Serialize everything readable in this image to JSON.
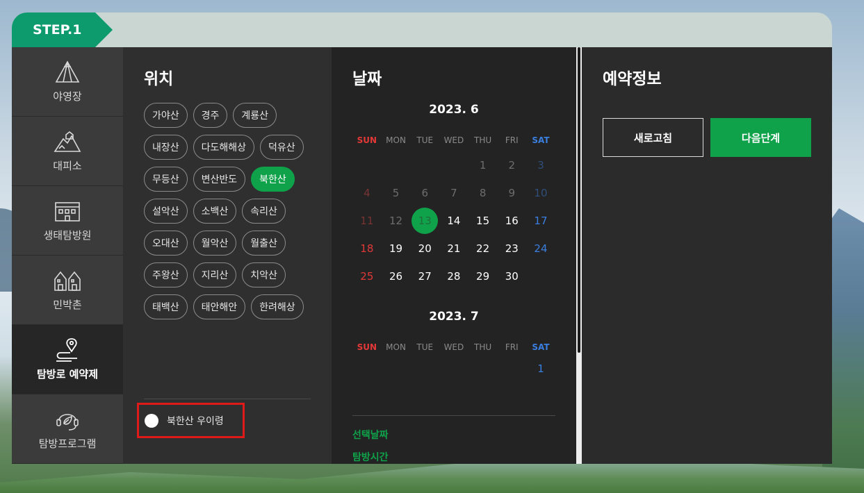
{
  "step": {
    "label": "STEP.1"
  },
  "sidebar": {
    "items": [
      {
        "label": "야영장",
        "icon": "tent-icon",
        "active": false
      },
      {
        "label": "대피소",
        "icon": "mountain-shelter-icon",
        "active": false
      },
      {
        "label": "생태탐방원",
        "icon": "building-icon",
        "active": false
      },
      {
        "label": "민박촌",
        "icon": "houses-icon",
        "active": false
      },
      {
        "label": "탐방로 예약제",
        "icon": "trail-pin-icon",
        "active": true
      },
      {
        "label": "탐방프로그램",
        "icon": "leaf-headset-icon",
        "active": false
      }
    ]
  },
  "location": {
    "title": "위치",
    "parks": [
      "가야산",
      "경주",
      "계룡산",
      "내장산",
      "다도해해상",
      "덕유산",
      "무등산",
      "변산반도",
      "북한산",
      "설악산",
      "소백산",
      "속리산",
      "오대산",
      "월악산",
      "월출산",
      "주왕산",
      "지리산",
      "치악산",
      "태백산",
      "태안해안",
      "한려해상"
    ],
    "selected": "북한산",
    "trail_option": "북한산 우이령"
  },
  "date": {
    "title": "날짜",
    "weekdays": [
      "SUN",
      "MON",
      "TUE",
      "WED",
      "THU",
      "FRI",
      "SAT"
    ],
    "month1": {
      "label": "2023. 6",
      "weeks": [
        [
          "",
          "",
          "",
          "",
          "1",
          "2",
          "3"
        ],
        [
          "4",
          "5",
          "6",
          "7",
          "8",
          "9",
          "10"
        ],
        [
          "11",
          "12",
          "13",
          "14",
          "15",
          "16",
          "17"
        ],
        [
          "18",
          "19",
          "20",
          "21",
          "22",
          "23",
          "24"
        ],
        [
          "25",
          "26",
          "27",
          "28",
          "29",
          "30",
          ""
        ]
      ],
      "today": "13"
    },
    "month2": {
      "label": "2023. 7",
      "weeks": [
        [
          "",
          "",
          "",
          "",
          "",
          "",
          "1"
        ]
      ]
    },
    "selected_date_label": "선택날짜",
    "visit_time_label": "탐방시간"
  },
  "info": {
    "title": "예약정보",
    "refresh_label": "새로고침",
    "next_label": "다음단계"
  },
  "colors": {
    "accent": "#0fa24a",
    "step": "#0d9a6c",
    "sunday": "#e23838",
    "saturday": "#3a7fe0"
  }
}
